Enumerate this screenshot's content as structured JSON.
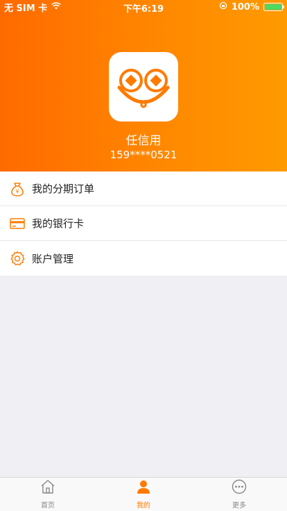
{
  "status_bar": {
    "carrier": "无 SIM 卡",
    "time": "下午6:19",
    "battery": "100%"
  },
  "profile": {
    "name": "任信用",
    "phone": "159****0521"
  },
  "menu": {
    "items": [
      {
        "label": "我的分期订单",
        "icon": "money-bag-icon"
      },
      {
        "label": "我的银行卡",
        "icon": "bank-card-icon"
      },
      {
        "label": "账户管理",
        "icon": "gear-icon"
      }
    ]
  },
  "tabbar": {
    "tabs": [
      {
        "label": "首页",
        "icon": "home-icon"
      },
      {
        "label": "我的",
        "icon": "person-icon"
      },
      {
        "label": "更多",
        "icon": "more-icon"
      }
    ],
    "active": "我的"
  },
  "colors": {
    "accent": "#ff7a00",
    "header_start": "#ff6a00",
    "header_end": "#ff9a00"
  }
}
